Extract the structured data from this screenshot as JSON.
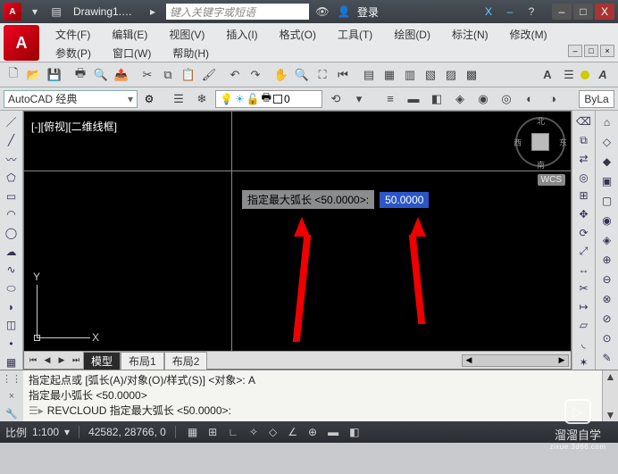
{
  "title_bar": {
    "doc_name": "Drawing1.d...",
    "search_placeholder": "键入关键字或短语",
    "login_label": "登录",
    "x_icon": "X",
    "dash_icon": "–",
    "help_icon": "?",
    "min_icon": "–",
    "max_icon": "□",
    "close_icon": "X"
  },
  "menu": {
    "items_row1": [
      "文件(F)",
      "编辑(E)",
      "视图(V)",
      "插入(I)",
      "格式(O)",
      "工具(T)",
      "绘图(D)",
      "标注(N)",
      "修改(M)"
    ],
    "items_row2": [
      "参数(P)",
      "窗口(W)",
      "帮助(H)"
    ]
  },
  "workspace": {
    "combo_label": "AutoCAD 经典",
    "bylayer": "ByLa"
  },
  "viewport": {
    "label": "[-][俯视][二维线框]",
    "y": "Y",
    "x": "X",
    "wcs": "WCS",
    "n": "北",
    "s": "南",
    "e": "东",
    "w": "西"
  },
  "prompt": {
    "text": "指定最大弧长 <50.0000>:",
    "input_value": "50.0000"
  },
  "tabs": {
    "model": "模型",
    "layout1": "布局1",
    "layout2": "布局2"
  },
  "command": {
    "line1": "指定起点或 [弧长(A)/对象(O)/样式(S)] <对象>: A",
    "line2": "指定最小弧长 <50.0000>",
    "prompt_cmd": "REVCLOUD 指定最大弧长 <50.0000>:",
    "caret": "⌨"
  },
  "status": {
    "scale_label": "比例",
    "scale_value": "1:100",
    "coords": "42582, 28766, 0"
  },
  "watermark": {
    "title": "溜溜自学",
    "url": "zixue.3d66.com",
    "play": "▷"
  }
}
